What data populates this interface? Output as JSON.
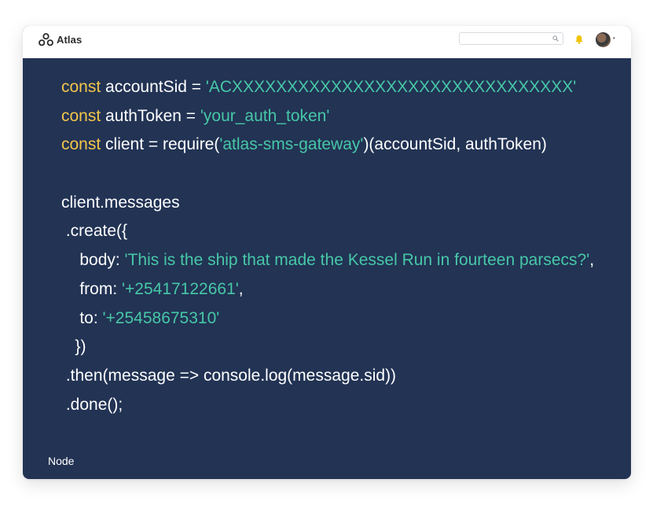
{
  "header": {
    "brand": "Atlas",
    "search_placeholder": "",
    "icons": [
      "atlas-logo-icon",
      "search-icon",
      "bell-icon",
      "avatar"
    ]
  },
  "code": {
    "lines": [
      [
        {
          "t": "const",
          "c": "kw"
        },
        {
          "t": " accountSid = ",
          "c": "txt"
        },
        {
          "t": "'ACXXXXXXXXXXXXXXXXXXXXXXXXXXXXXXX'",
          "c": "str"
        }
      ],
      [
        {
          "t": "const",
          "c": "kw"
        },
        {
          "t": " authToken = ",
          "c": "txt"
        },
        {
          "t": "'your_auth_token'",
          "c": "str"
        }
      ],
      [
        {
          "t": "const",
          "c": "kw"
        },
        {
          "t": " client = require(",
          "c": "txt"
        },
        {
          "t": "'atlas-sms-gateway'",
          "c": "str"
        },
        {
          "t": ")(accountSid, authToken)",
          "c": "txt"
        }
      ],
      [],
      [
        {
          "t": "client.messages",
          "c": "txt"
        }
      ],
      [
        {
          "t": " .create({",
          "c": "txt"
        }
      ],
      [
        {
          "t": "    body: ",
          "c": "txt"
        },
        {
          "t": "'This is the ship that made the Kessel Run in fourteen parsecs?'",
          "c": "str"
        },
        {
          "t": ",",
          "c": "txt"
        }
      ],
      [
        {
          "t": "    from: ",
          "c": "txt"
        },
        {
          "t": "'+25417122661'",
          "c": "str"
        },
        {
          "t": ",",
          "c": "txt"
        }
      ],
      [
        {
          "t": "    to: ",
          "c": "txt"
        },
        {
          "t": "'+25458675310'",
          "c": "str"
        }
      ],
      [
        {
          "t": "   })",
          "c": "txt"
        }
      ],
      [
        {
          "t": " .then(message => console.log(message.sid))",
          "c": "txt"
        }
      ],
      [
        {
          "t": " .done();",
          "c": "txt"
        }
      ]
    ]
  },
  "footer": {
    "tabs": [
      {
        "label": "Node",
        "active": true
      },
      {
        "label": "",
        "active": false
      },
      {
        "label": "",
        "active": false
      },
      {
        "label": "",
        "active": false
      },
      {
        "label": "",
        "active": false
      },
      {
        "label": "",
        "active": false
      },
      {
        "label": "",
        "active": false
      },
      {
        "label": "",
        "active": false
      }
    ]
  },
  "colors": {
    "background": "#223354",
    "keyword": "#f4c54a",
    "string": "#47c7a7",
    "text": "#ffffff",
    "topbar": "#ffffff",
    "bell": "#f2c200"
  }
}
